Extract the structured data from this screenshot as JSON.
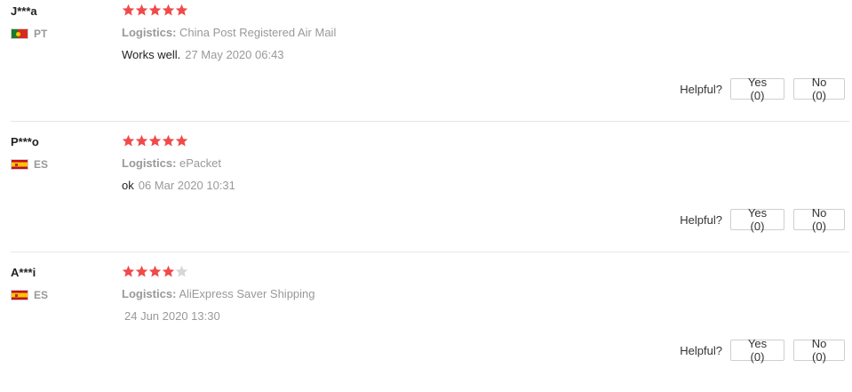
{
  "reviews": [
    {
      "user": "J***a",
      "country_code": "PT",
      "rating": 5,
      "logistics_label": "Logistics:",
      "logistics": "China Post Registered Air Mail",
      "text": "Works well.",
      "date": "27 May 2020 06:43",
      "helpful_label": "Helpful?",
      "yes_label": "Yes (0)",
      "no_label": "No (0)"
    },
    {
      "user": "P***o",
      "country_code": "ES",
      "rating": 5,
      "logistics_label": "Logistics:",
      "logistics": "ePacket",
      "text": "ok",
      "date": "06 Mar 2020 10:31",
      "helpful_label": "Helpful?",
      "yes_label": "Yes (0)",
      "no_label": "No (0)"
    },
    {
      "user": "A***i",
      "country_code": "ES",
      "rating": 4,
      "logistics_label": "Logistics:",
      "logistics": "AliExpress Saver Shipping",
      "text": "",
      "date": "24 Jun 2020 13:30",
      "helpful_label": "Helpful?",
      "yes_label": "Yes (0)",
      "no_label": "No (0)"
    }
  ],
  "colors": {
    "star_filled": "#f04a4a",
    "star_empty": "#d6d6d6",
    "muted_text": "#999999",
    "divider": "#e6e6e6"
  },
  "icons": {
    "star": "star-icon",
    "flag_pt": "flag-pt-icon",
    "flag_es": "flag-es-icon"
  }
}
